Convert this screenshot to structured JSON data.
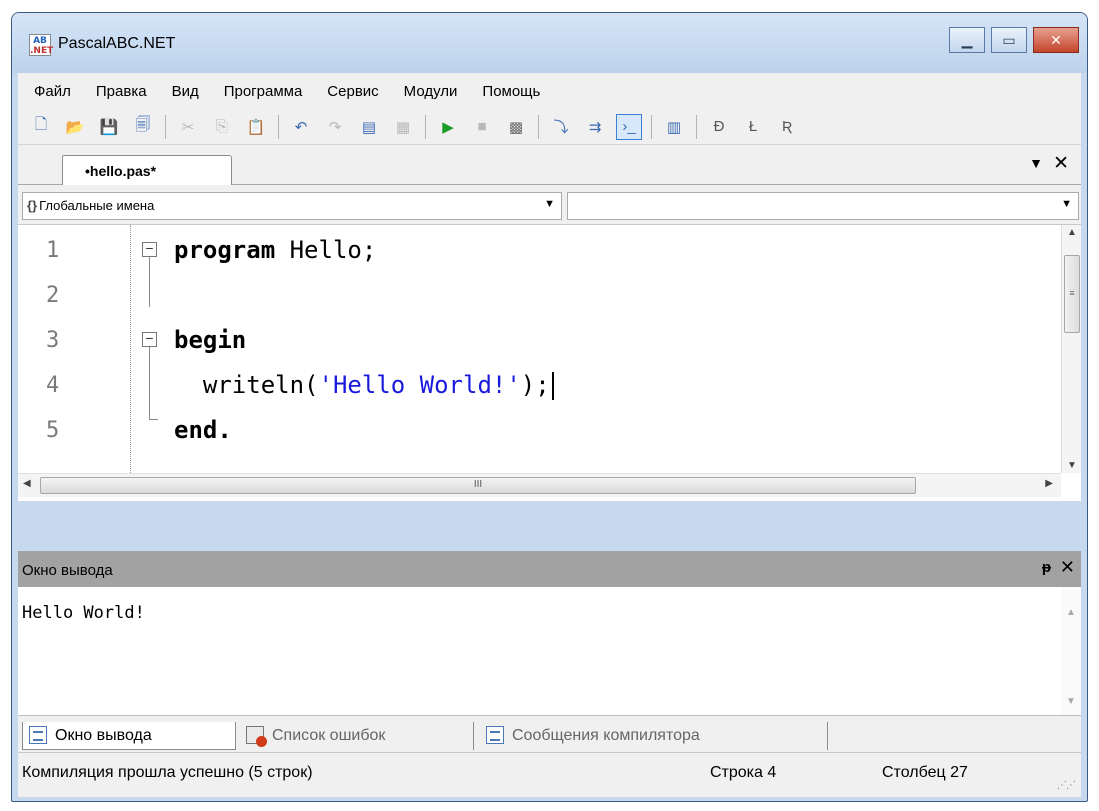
{
  "window": {
    "title": "PascalABC.NET",
    "app_icon": "pascalabc-icon",
    "buttons": [
      "minimize",
      "maximize",
      "close"
    ]
  },
  "menu": {
    "items": [
      {
        "label": "Файл"
      },
      {
        "label": "Правка"
      },
      {
        "label": "Вид"
      },
      {
        "label": "Программа"
      },
      {
        "label": "Сервис"
      },
      {
        "label": "Модули"
      },
      {
        "label": "Помощь"
      }
    ]
  },
  "toolbar": {
    "icons": [
      "new-file-icon",
      "open-folder-icon",
      "save-icon",
      "save-all-icon",
      "cut-icon",
      "copy-icon",
      "paste-icon",
      "undo-icon",
      "redo-icon",
      "comment-icon",
      "uncomment-icon",
      "run-icon",
      "stop-icon",
      "compile-icon",
      "step-into-icon",
      "step-over-icon",
      "console-icon",
      "output-icon",
      "format-icon",
      "format-l-icon",
      "format-r-icon"
    ]
  },
  "editor_tab": {
    "label": "•hello.pas*"
  },
  "scope_combo": {
    "icon_text": "{}",
    "value": "Глобальные имена"
  },
  "member_combo": {
    "value": ""
  },
  "code": {
    "line_numbers": [
      "1",
      "2",
      "3",
      "4",
      "5"
    ],
    "line1_kw": "program",
    "line1_rest": " Hello;",
    "line3_kw": "begin",
    "line4_pre": "  writeln(",
    "line4_str": "'Hello World!'",
    "line4_post": ");",
    "line5_kw": "end",
    "line5_post": "."
  },
  "hscroll_grip": "III",
  "output": {
    "title": "Окно вывода",
    "pin": "ᵽ",
    "close": "✕",
    "text": "Hello World!"
  },
  "bottom_tabs": [
    {
      "label": "Окно вывода",
      "active": true
    },
    {
      "label": "Список ошибок",
      "active": false
    },
    {
      "label": "Сообщения компилятора",
      "active": false
    }
  ],
  "status": {
    "message": "Компиляция прошла успешно (5 строк)",
    "row": "Строка 4",
    "col": "Столбец 27"
  }
}
